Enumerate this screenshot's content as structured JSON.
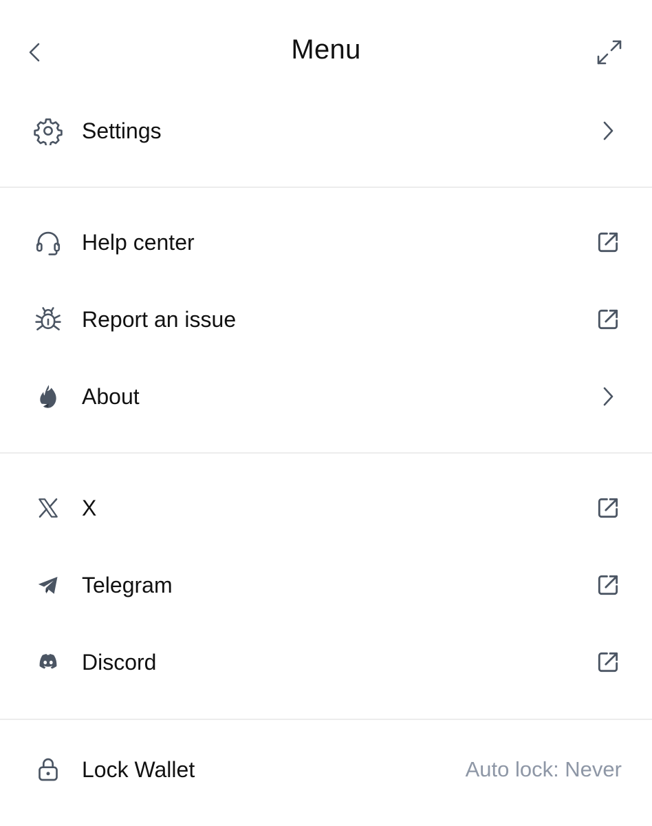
{
  "header": {
    "title": "Menu",
    "back_icon": "chevron-left-icon",
    "expand_icon": "expand-icon"
  },
  "sections": [
    {
      "items": [
        {
          "label": "Settings",
          "icon": "gear-icon",
          "trailing": "chevron-right-icon"
        }
      ]
    },
    {
      "items": [
        {
          "label": "Help center",
          "icon": "headset-icon",
          "trailing": "external-link-icon"
        },
        {
          "label": "Report an issue",
          "icon": "bug-icon",
          "trailing": "external-link-icon"
        },
        {
          "label": "About",
          "icon": "flame-logo-icon",
          "trailing": "chevron-right-icon"
        }
      ]
    },
    {
      "items": [
        {
          "label": "X",
          "icon": "x-logo-icon",
          "trailing": "external-link-icon"
        },
        {
          "label": "Telegram",
          "icon": "telegram-icon",
          "trailing": "external-link-icon"
        },
        {
          "label": "Discord",
          "icon": "discord-icon",
          "trailing": "external-link-icon"
        }
      ]
    }
  ],
  "lock": {
    "label": "Lock Wallet",
    "icon": "lock-icon",
    "auto_lock_text": "Auto lock: Never"
  },
  "colors": {
    "text": "#111111",
    "icon": "#4b5563",
    "muted": "#8e97a6",
    "divider": "#ececec"
  }
}
